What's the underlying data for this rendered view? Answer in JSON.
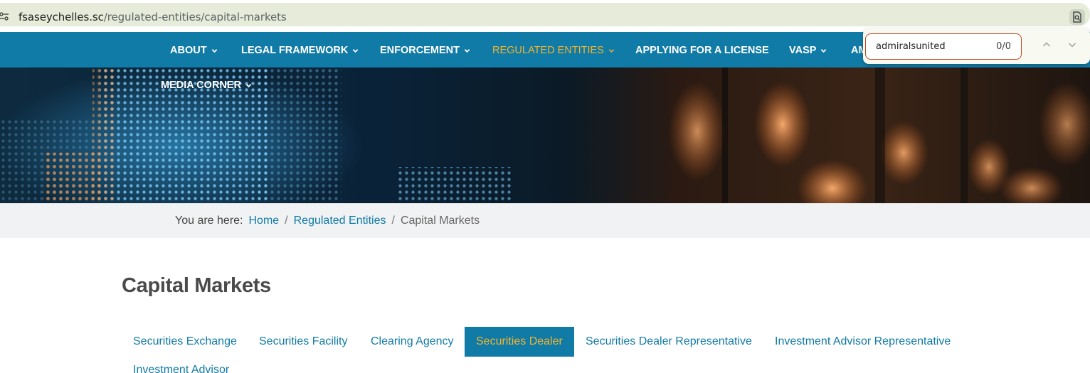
{
  "browser": {
    "url_domain": "fsaseychelles.sc",
    "url_path": "/regulated-entities/capital-markets",
    "site_icon": "tune-icon",
    "page_action_icon": "find-in-page-icon"
  },
  "nav": {
    "items": [
      {
        "label": "ABOUT",
        "has_dropdown": true
      },
      {
        "label": "LEGAL FRAMEWORK",
        "has_dropdown": true
      },
      {
        "label": "ENFORCEMENT",
        "has_dropdown": true
      },
      {
        "label": "REGULATED ENTITIES",
        "has_dropdown": true,
        "active": true
      },
      {
        "label": "APPLYING FOR A LICENSE",
        "has_dropdown": false
      },
      {
        "label": "VASP",
        "has_dropdown": true
      },
      {
        "label": "AM",
        "has_dropdown": false
      }
    ],
    "second_row": {
      "label": "MEDIA CORNER",
      "has_dropdown": true
    },
    "colors": {
      "bar": "#117ba7",
      "active": "#f2b430",
      "text": "#ffffff"
    }
  },
  "find_bar": {
    "query": "admiralsunited",
    "count": "0/0",
    "prev_icon": "chevron-up-icon",
    "next_icon": "chevron-down-icon"
  },
  "breadcrumb": {
    "prefix": "You are here:",
    "items": [
      {
        "label": "Home",
        "link": true
      },
      {
        "label": "Regulated Entities",
        "link": true
      },
      {
        "label": "Capital Markets",
        "link": false
      }
    ],
    "separator": "/"
  },
  "page_title": "Capital Markets",
  "tabs": [
    {
      "label": "Securities Exchange",
      "active": false
    },
    {
      "label": "Securities Facility",
      "active": false
    },
    {
      "label": "Clearing Agency",
      "active": false
    },
    {
      "label": "Securities Dealer",
      "active": true
    },
    {
      "label": "Securities Dealer Representative",
      "active": false
    },
    {
      "label": "Investment Advisor Representative",
      "active": false
    },
    {
      "label": "Investment Advisor",
      "active": false
    }
  ]
}
